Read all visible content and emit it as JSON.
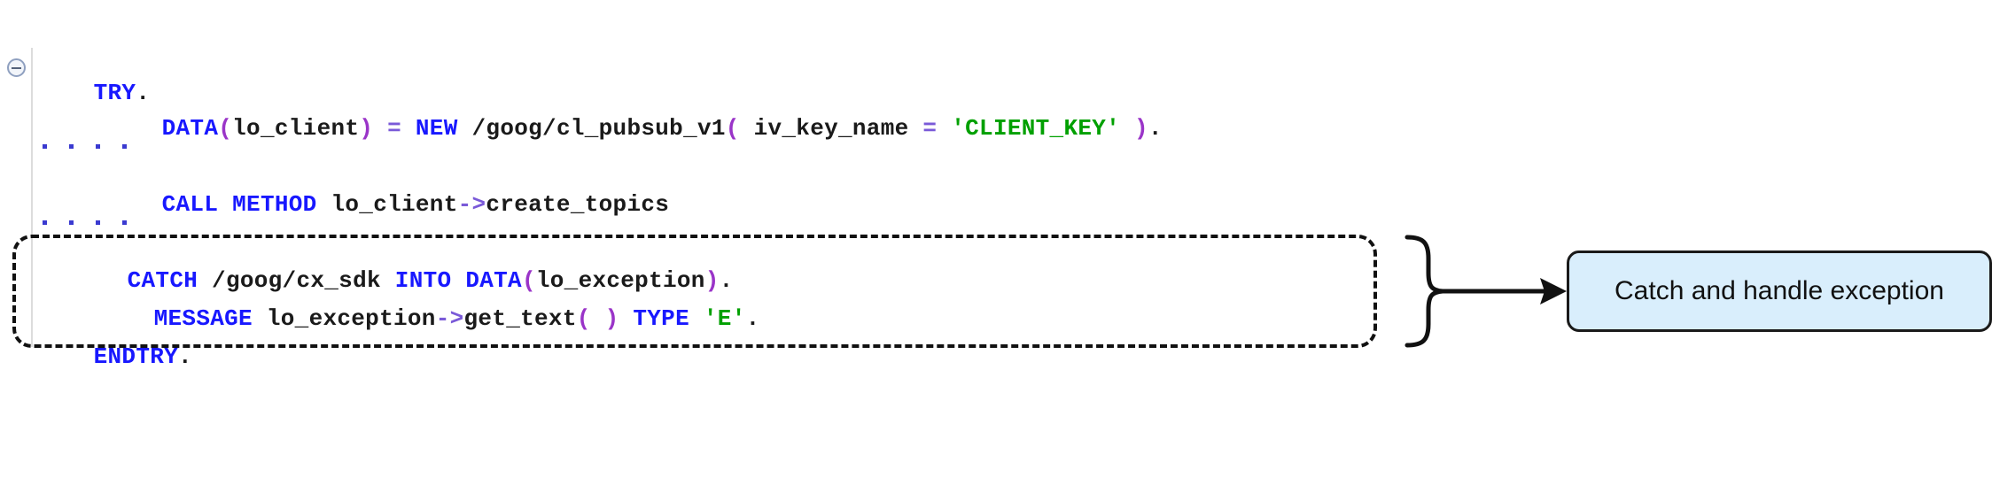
{
  "editor": {
    "collapse_icon": "collapse-minus-icon",
    "lines": [
      {
        "id": "line-try",
        "tokens": [
          {
            "t": "TRY",
            "c": "kw"
          },
          {
            "t": ".",
            "c": "punct"
          }
        ],
        "text": "TRY."
      },
      {
        "id": "line-data-client",
        "tokens": [
          {
            "t": "DATA",
            "c": "kw"
          },
          {
            "t": "(",
            "c": "paren"
          },
          {
            "t": "lo_client",
            "c": "ident"
          },
          {
            "t": ")",
            "c": "paren"
          },
          {
            "t": " ",
            "c": "punct"
          },
          {
            "t": "=",
            "c": "op"
          },
          {
            "t": " ",
            "c": "punct"
          },
          {
            "t": "NEW",
            "c": "kw"
          },
          {
            "t": " ",
            "c": "punct"
          },
          {
            "t": "/goog/cl_pubsub_v1",
            "c": "ident"
          },
          {
            "t": "(",
            "c": "paren"
          },
          {
            "t": " iv_key_name ",
            "c": "ident"
          },
          {
            "t": "=",
            "c": "op"
          },
          {
            "t": " ",
            "c": "punct"
          },
          {
            "t": "'CLIENT_KEY'",
            "c": "str"
          },
          {
            "t": " ",
            "c": "punct"
          },
          {
            "t": ")",
            "c": "paren"
          },
          {
            "t": ".",
            "c": "punct"
          }
        ],
        "text": "DATA(lo_client) = NEW /goog/cl_pubsub_v1( iv_key_name = 'CLIENT_KEY' )."
      },
      {
        "id": "line-call-method",
        "tokens": [
          {
            "t": "CALL",
            "c": "kw"
          },
          {
            "t": " ",
            "c": "punct"
          },
          {
            "t": "METHOD",
            "c": "kw"
          },
          {
            "t": " ",
            "c": "punct"
          },
          {
            "t": "lo_client",
            "c": "ident"
          },
          {
            "t": "->",
            "c": "op"
          },
          {
            "t": "create_topics",
            "c": "ident"
          }
        ],
        "text": "CALL METHOD lo_client->create_topics"
      },
      {
        "id": "line-catch",
        "tokens": [
          {
            "t": "CATCH",
            "c": "kw"
          },
          {
            "t": " ",
            "c": "punct"
          },
          {
            "t": "/goog/cx_sdk",
            "c": "ident"
          },
          {
            "t": " ",
            "c": "punct"
          },
          {
            "t": "INTO",
            "c": "kw"
          },
          {
            "t": " ",
            "c": "punct"
          },
          {
            "t": "DATA",
            "c": "kw"
          },
          {
            "t": "(",
            "c": "paren"
          },
          {
            "t": "lo_exception",
            "c": "ident"
          },
          {
            "t": ")",
            "c": "paren"
          },
          {
            "t": ".",
            "c": "punct"
          }
        ],
        "text": "CATCH /goog/cx_sdk INTO DATA(lo_exception)."
      },
      {
        "id": "line-message",
        "tokens": [
          {
            "t": "MESSAGE",
            "c": "kw"
          },
          {
            "t": " ",
            "c": "punct"
          },
          {
            "t": "lo_exception",
            "c": "ident"
          },
          {
            "t": "->",
            "c": "op"
          },
          {
            "t": "get_text",
            "c": "ident"
          },
          {
            "t": "(",
            "c": "paren"
          },
          {
            "t": " ",
            "c": "punct"
          },
          {
            "t": ")",
            "c": "paren"
          },
          {
            "t": " ",
            "c": "punct"
          },
          {
            "t": "TYPE",
            "c": "kw"
          },
          {
            "t": " ",
            "c": "punct"
          },
          {
            "t": "'E'",
            "c": "str"
          },
          {
            "t": ".",
            "c": "punct"
          }
        ],
        "text": "MESSAGE lo_exception->get_text( ) TYPE 'E'."
      },
      {
        "id": "line-endtry",
        "tokens": [
          {
            "t": "ENDTRY",
            "c": "kw"
          },
          {
            "t": ".",
            "c": "punct"
          }
        ],
        "text": "ENDTRY."
      }
    ],
    "ellipsis_rows": [
      {
        "id": "ellipsis-row-1",
        "dots": 4
      },
      {
        "id": "ellipsis-row-2",
        "dots": 4
      }
    ]
  },
  "annotation": {
    "callout_label": "Catch and handle exception",
    "highlight_style": "dashed-rounded-rectangle",
    "connector": "curly-brace-with-arrow"
  },
  "colors": {
    "keyword": "#1818ff",
    "identifier": "#1a1a1a",
    "string": "#00a000",
    "operator": "#7a5ad8",
    "paren": "#9a34c8",
    "callout_fill": "#d9eefc",
    "callout_border": "#1a1a1a",
    "highlight_border": "#111111",
    "indent_guide": "#dcdcdc",
    "page_background": "#ffffff"
  }
}
